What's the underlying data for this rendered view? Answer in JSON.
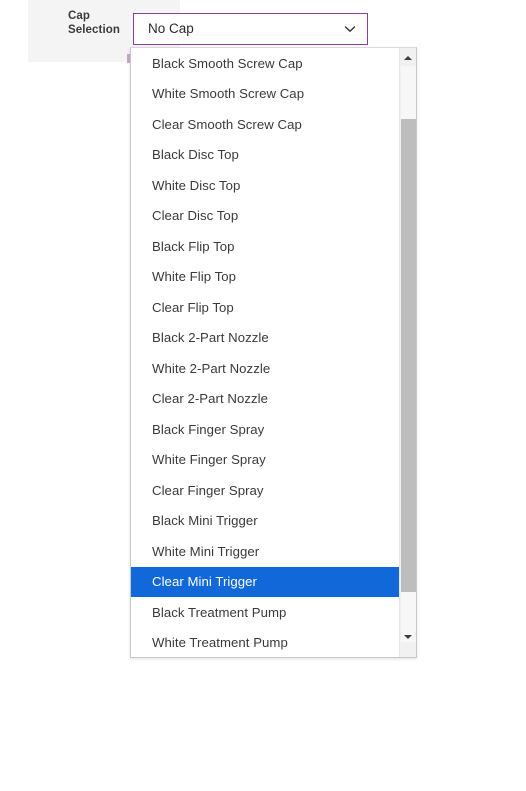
{
  "form": {
    "field": {
      "label": "Cap Selection",
      "label_line1": "Cap",
      "label_line2": "Selection"
    }
  },
  "combobox": {
    "name": "cap-selection",
    "selected_value": "No Cap",
    "expanded": true,
    "border_color": "#8a3f9e",
    "chevron_icon": "chevron-down-icon"
  },
  "dropdown": {
    "highlight_color": "#1168d9",
    "highlighted_option": "Clear Mini Trigger",
    "visible_options": [
      {
        "label": "Black Smooth Screw Cap",
        "selected": false
      },
      {
        "label": "White Smooth Screw Cap",
        "selected": false
      },
      {
        "label": "Clear Smooth Screw Cap",
        "selected": false
      },
      {
        "label": "Black Disc Top",
        "selected": false
      },
      {
        "label": "White Disc Top",
        "selected": false
      },
      {
        "label": "Clear Disc Top",
        "selected": false
      },
      {
        "label": "Black Flip Top",
        "selected": false
      },
      {
        "label": "White Flip Top",
        "selected": false
      },
      {
        "label": "Clear Flip Top",
        "selected": false
      },
      {
        "label": "Black 2-Part Nozzle",
        "selected": false
      },
      {
        "label": "White 2-Part Nozzle",
        "selected": false
      },
      {
        "label": "Clear 2-Part Nozzle",
        "selected": false
      },
      {
        "label": "Black Finger Spray",
        "selected": false
      },
      {
        "label": "White Finger Spray",
        "selected": false
      },
      {
        "label": "Clear Finger Spray",
        "selected": false
      },
      {
        "label": "Black Mini Trigger",
        "selected": false
      },
      {
        "label": "White Mini Trigger",
        "selected": false
      },
      {
        "label": "Clear Mini Trigger",
        "selected": true
      },
      {
        "label": "Black Treatment Pump",
        "selected": false
      },
      {
        "label": "White Treatment Pump",
        "selected": false
      }
    ],
    "scrollbar": {
      "up_arrow_icon": "scroll-up-arrow-icon",
      "down_arrow_icon": "scroll-down-arrow-icon",
      "thumb_icon": "scrollbar-thumb"
    }
  }
}
